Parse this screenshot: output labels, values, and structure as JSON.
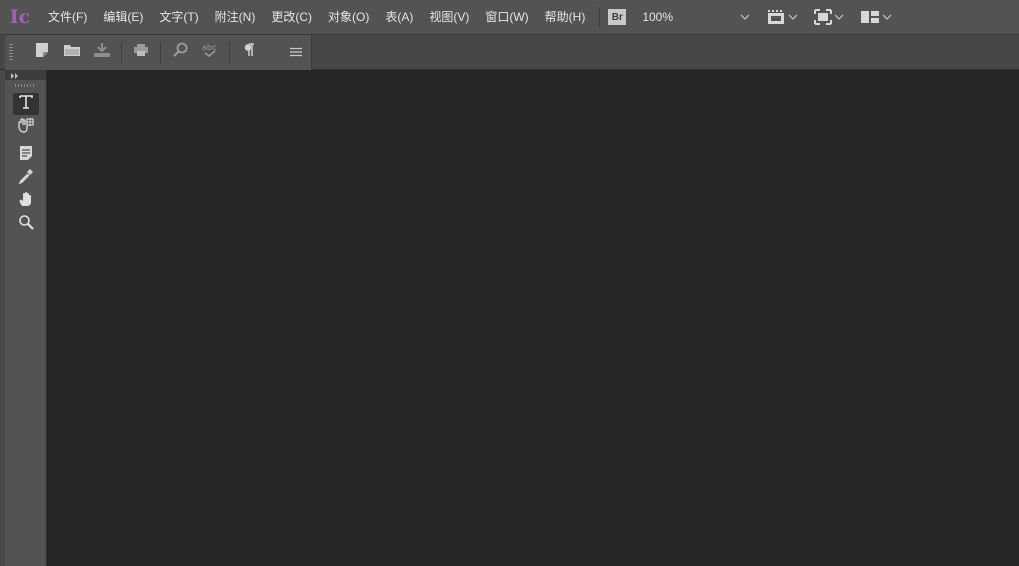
{
  "app": {
    "logo_text": "Ic"
  },
  "menu": {
    "items": [
      "文件(F)",
      "编辑(E)",
      "文字(T)",
      "附注(N)",
      "更改(C)",
      "对象(O)",
      "表(A)",
      "视图(V)",
      "窗口(W)",
      "帮助(H)"
    ]
  },
  "bridge": {
    "label": "Br"
  },
  "zoom": {
    "value": "100%"
  },
  "icons": {
    "menubar": [
      "screen-mode-icon",
      "fit-frame-icon",
      "workspace-layout-icon"
    ],
    "toolbar": [
      "new-document-icon",
      "open-folder-icon",
      "save-download-icon",
      "print-icon",
      "find-icon",
      "spell-check-icon",
      "paragraph-icon",
      "panel-menu-icon"
    ],
    "tools": [
      "type-tool-icon",
      "position-tool-icon",
      "note-tool-icon",
      "eyedropper-tool-icon",
      "hand-tool-icon",
      "zoom-tool-icon"
    ]
  },
  "colors": {
    "accent": "#a35fb5",
    "chrome": "#535353",
    "canvas": "#262626"
  }
}
